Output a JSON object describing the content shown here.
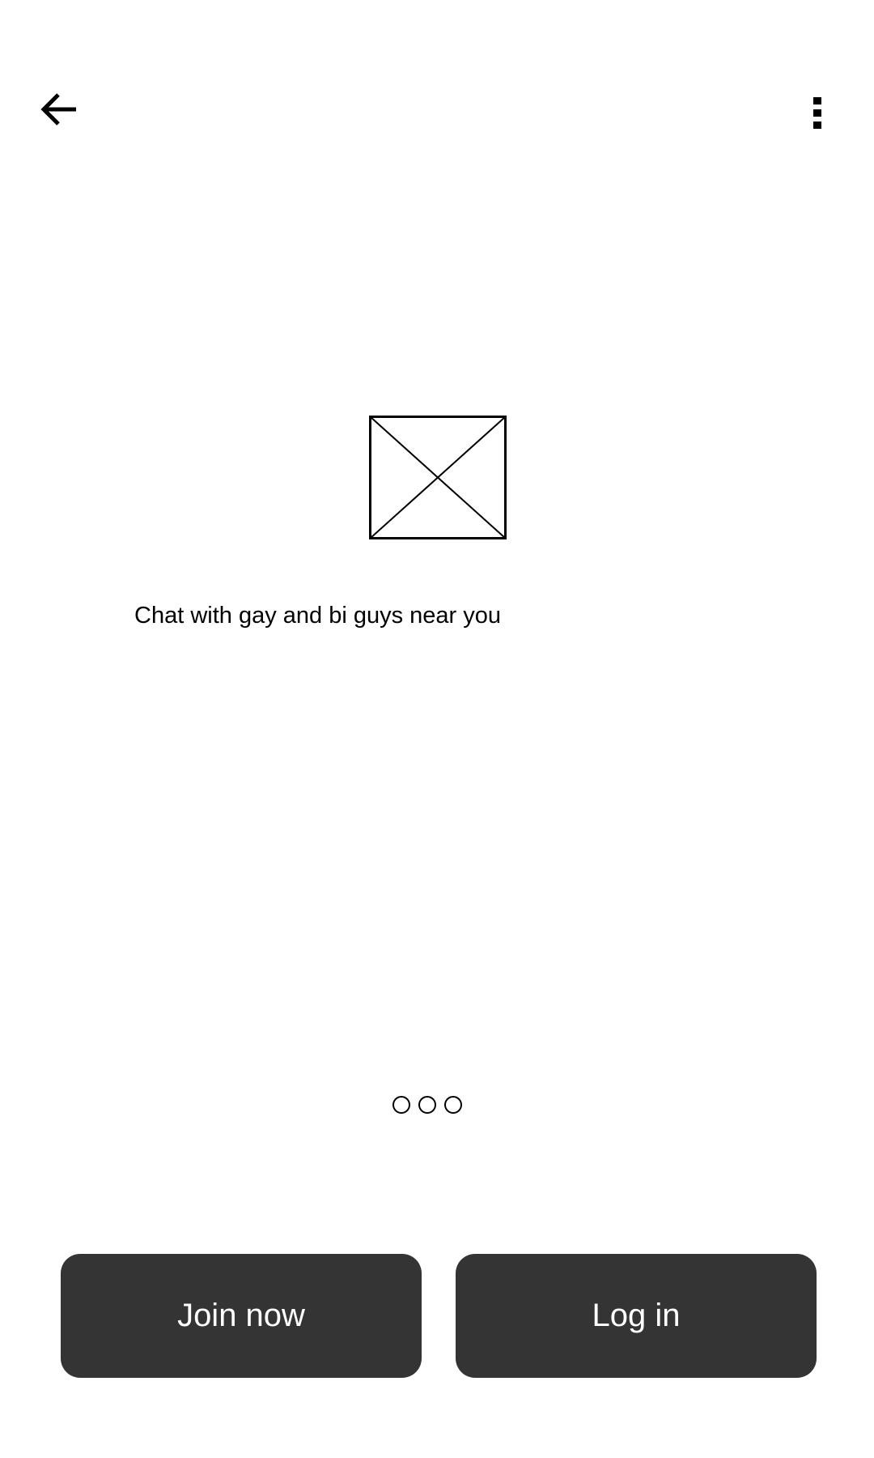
{
  "header": {
    "back_icon": "arrow-left-icon",
    "menu_icon": "more-vertical-icon"
  },
  "hero": {
    "image_icon": "image-placeholder-icon",
    "tagline": "Chat with gay and bi guys near you"
  },
  "pager": {
    "count": 3,
    "dots": [
      "",
      "",
      ""
    ]
  },
  "actions": {
    "join_label": "Join now",
    "login_label": "Log in"
  },
  "colors": {
    "button_bg": "#343434",
    "button_text": "#ffffff",
    "background": "#ffffff"
  }
}
